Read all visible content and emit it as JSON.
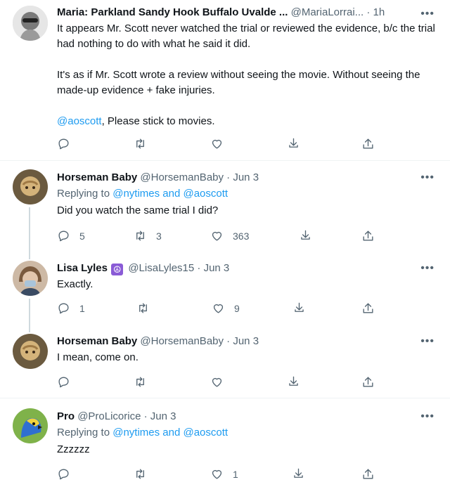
{
  "tweets": [
    {
      "name": "Maria: Parkland Sandy Hook Buffalo Uvalde ...",
      "handle": "@MariaLorrai...",
      "dot": "·",
      "time": "1h",
      "lines": [
        "It appears Mr. Scott never watched the trial or reviewed the evidence, b/c the trial had nothing to do with what he said it did.",
        "It's as if Mr. Scott wrote a review without seeing the movie. Without seeing the made-up evidence + fake injuries."
      ],
      "mention": "@aoscott",
      "mention_rest": ", Please stick to movies.",
      "reply_count": "",
      "retweet_count": "",
      "like_count": ""
    },
    {
      "name": "Horseman Baby",
      "handle": "@HorsemanBaby",
      "dot": "·",
      "time": "Jun 3",
      "replying_prefix": "Replying to ",
      "replying_to": "@nytimes and @aoscott",
      "text": "Did you watch the same trial I did?",
      "reply_count": "5",
      "retweet_count": "3",
      "like_count": "363"
    },
    {
      "name": "Lisa Lyles",
      "badge": "☮",
      "handle": "@LisaLyles15",
      "dot": "·",
      "time": "Jun 3",
      "text": "Exactly.",
      "reply_count": "1",
      "retweet_count": "",
      "like_count": "9"
    },
    {
      "name": "Horseman Baby",
      "handle": "@HorsemanBaby",
      "dot": "·",
      "time": "Jun 3",
      "text": "I mean, come on.",
      "reply_count": "",
      "retweet_count": "",
      "like_count": ""
    },
    {
      "name": "Pro",
      "handle": "@ProLicorice",
      "dot": "·",
      "time": "Jun 3",
      "replying_prefix": "Replying to ",
      "replying_to": "@nytimes and @aoscott",
      "text": "Zzzzzz",
      "reply_count": "",
      "retweet_count": "",
      "like_count": "1"
    }
  ],
  "more_label": "•••",
  "icons": [
    "reply-icon",
    "retweet-icon",
    "like-icon",
    "share-icon",
    "upload-icon"
  ],
  "colors": {
    "link": "#1d9bf0",
    "muted": "#536471",
    "divider": "#eff3f4"
  }
}
